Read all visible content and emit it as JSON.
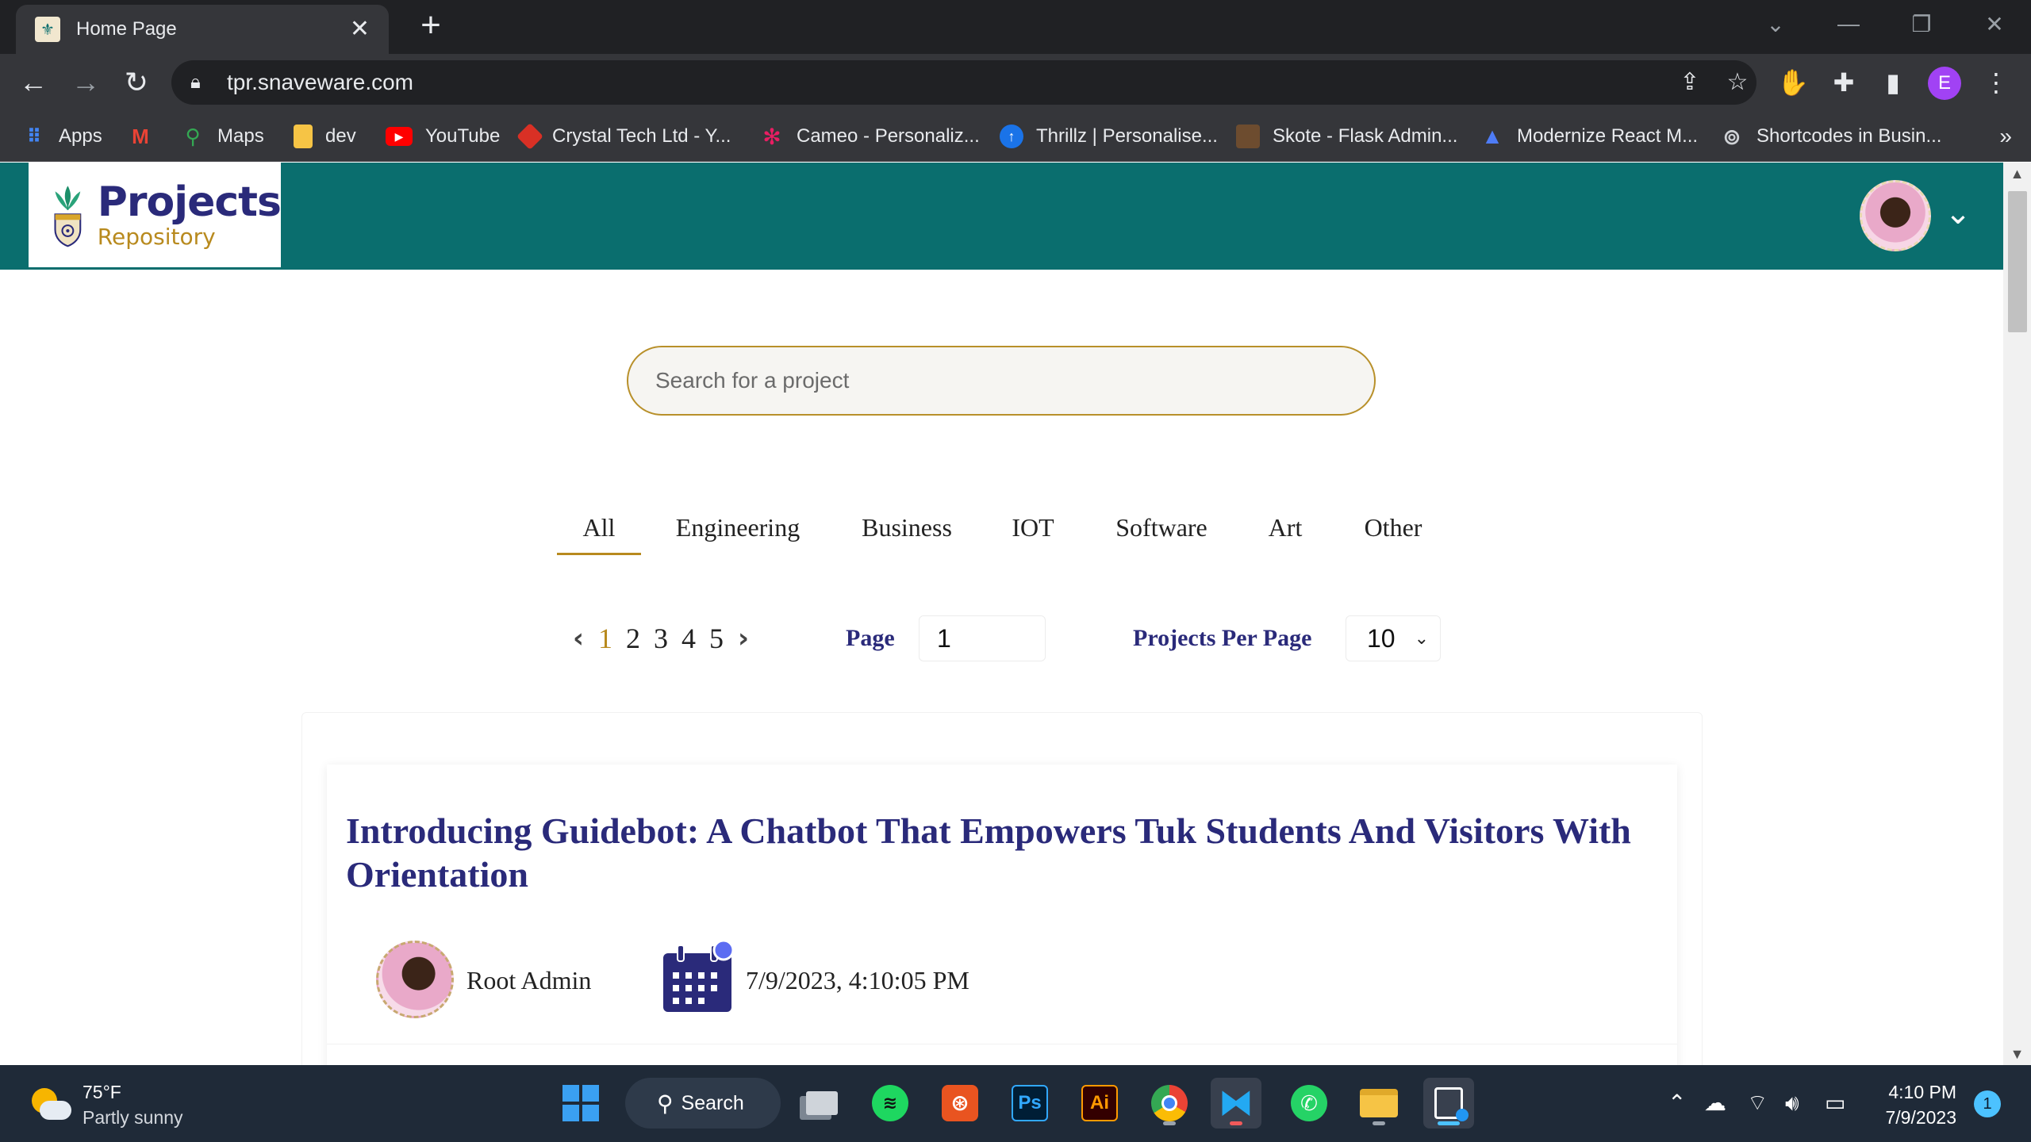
{
  "browser": {
    "tab": {
      "title": "Home Page",
      "close": "✕",
      "new_tab": "+"
    },
    "window_controls": {
      "dropdown": "⌄",
      "minimize": "—",
      "restore": "❐",
      "close": "✕"
    },
    "address": "tpr.snaveware.com",
    "profile_initial": "E",
    "bookmarks": [
      {
        "label": "Apps",
        "icon": "apps-grid-icon",
        "color": "#4285f4"
      },
      {
        "label": "",
        "icon": "gmail-icon",
        "color": "#ea4335"
      },
      {
        "label": "Maps",
        "icon": "maps-pin-icon",
        "color": "#34a853"
      },
      {
        "label": "dev",
        "icon": "folder-icon",
        "color": "#f6c445"
      },
      {
        "label": "YouTube",
        "icon": "youtube-icon",
        "color": "#ff0000"
      },
      {
        "label": "Crystal Tech Ltd - Y...",
        "icon": "crystal-tech-icon",
        "color": "#d93025"
      },
      {
        "label": "Cameo - Personaliz...",
        "icon": "cameo-icon",
        "color": "#e91e63"
      },
      {
        "label": "Thrillz | Personalise...",
        "icon": "thrillz-icon",
        "color": "#1a73e8"
      },
      {
        "label": "Skote - Flask Admin...",
        "icon": "skote-icon",
        "color": "#6d4c2f"
      },
      {
        "label": "Modernize React M...",
        "icon": "modernize-icon",
        "color": "#4e7cf6"
      },
      {
        "label": "Shortcodes in Busin...",
        "icon": "shortcodes-icon",
        "color": "#9aa0a6"
      }
    ],
    "bookmarks_more": "»"
  },
  "site": {
    "logo": {
      "title": "Projects",
      "subtitle": "Repository"
    },
    "search": {
      "placeholder": "Search for a project",
      "value": ""
    },
    "categories": [
      "All",
      "Engineering",
      "Business",
      "IOT",
      "Software",
      "Art",
      "Other"
    ],
    "active_category": "All",
    "pagination": {
      "pages": [
        "1",
        "2",
        "3",
        "4",
        "5"
      ],
      "current": "1",
      "page_label": "Page",
      "page_value": "1",
      "per_page_label": "Projects Per Page",
      "per_page_value": "10"
    },
    "project": {
      "title": "Introducing Guidebot: A Chatbot That Empowers Tuk Students And Visitors With Orientation",
      "author": "Root Admin",
      "date": "7/9/2023, 4:10:05 PM"
    }
  },
  "taskbar": {
    "weather": {
      "temp": "75°F",
      "condition": "Partly sunny"
    },
    "search_label": "Search",
    "time": "4:10 PM",
    "date": "7/9/2023",
    "notifications": "1"
  },
  "colors": {
    "header_teal": "#0a6e6e",
    "navy": "#2a2a7a",
    "gold": "#b88a1e"
  }
}
